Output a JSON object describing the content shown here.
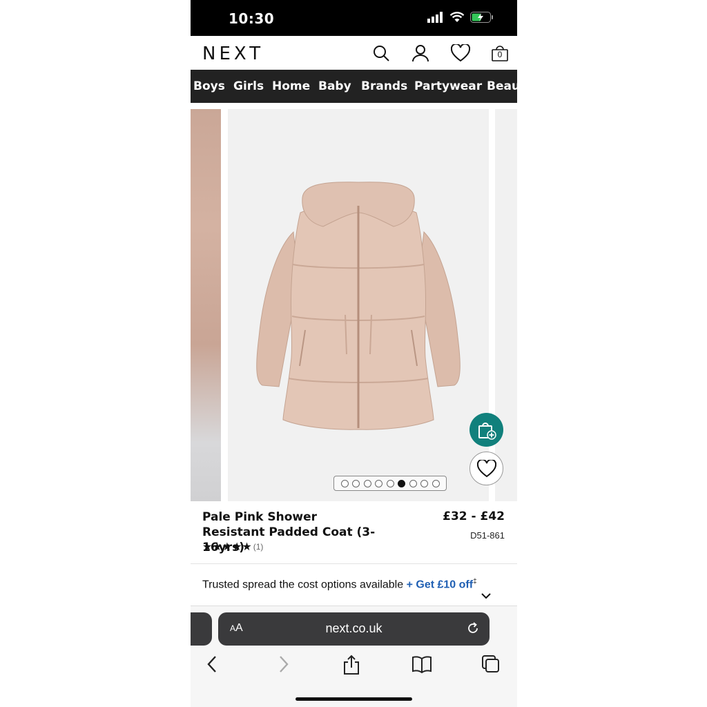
{
  "status": {
    "time": "10:30"
  },
  "header": {
    "logo": "NEXT",
    "bag_count": "0"
  },
  "nav": {
    "items": [
      "Boys",
      "Girls",
      "Home",
      "Baby",
      "Brands",
      "Partywear",
      "Beau"
    ]
  },
  "gallery": {
    "image_count": 9,
    "active_index": 5
  },
  "product": {
    "name": "Pale Pink Shower Resistant Padded Coat (3-16yrs)",
    "price": "£32 - £42",
    "sku": "D51-861",
    "rating": 5,
    "rating_stars": "★★★★★",
    "review_count": "(1)"
  },
  "promo": {
    "text": "Trusted spread the cost options available ",
    "link": "+ Get £10 off",
    "mark": "‡"
  },
  "browser": {
    "aa_large": "A",
    "aa_small": "A",
    "url": "next.co.uk"
  },
  "colors": {
    "accent": "#11807c",
    "link": "#1f5fb3",
    "nav_bg": "#222222",
    "coat": "#e0c3b3"
  }
}
